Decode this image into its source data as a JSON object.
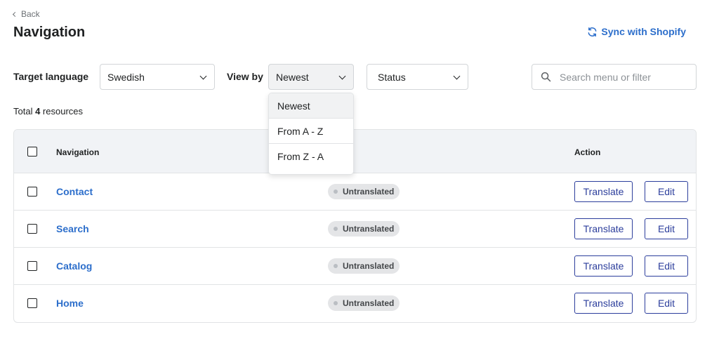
{
  "header": {
    "back_label": "Back",
    "title": "Navigation",
    "sync_label": "Sync with Shopify"
  },
  "filters": {
    "target_language_label": "Target language",
    "target_language_value": "Swedish",
    "view_by_label": "View by",
    "view_by_value": "Newest",
    "status_value": "Status",
    "search_placeholder": "Search menu or filter"
  },
  "dropdown": {
    "options": [
      "Newest",
      "From A - Z",
      "From Z - A"
    ],
    "selected": "Newest"
  },
  "summary": {
    "prefix": "Total ",
    "count": "4",
    "suffix": " resources"
  },
  "table": {
    "headers": {
      "navigation": "Navigation",
      "action": "Action"
    },
    "rows": [
      {
        "name": "Contact",
        "status": "Untranslated",
        "translate": "Translate",
        "edit": "Edit"
      },
      {
        "name": "Search",
        "status": "Untranslated",
        "translate": "Translate",
        "edit": "Edit"
      },
      {
        "name": "Catalog",
        "status": "Untranslated",
        "translate": "Translate",
        "edit": "Edit"
      },
      {
        "name": "Home",
        "status": "Untranslated",
        "translate": "Translate",
        "edit": "Edit"
      }
    ]
  },
  "colors": {
    "link": "#2c6ecb",
    "button_border": "#2c3e9c",
    "header_bg": "#f1f3f6",
    "badge_bg": "#e4e5e7"
  }
}
